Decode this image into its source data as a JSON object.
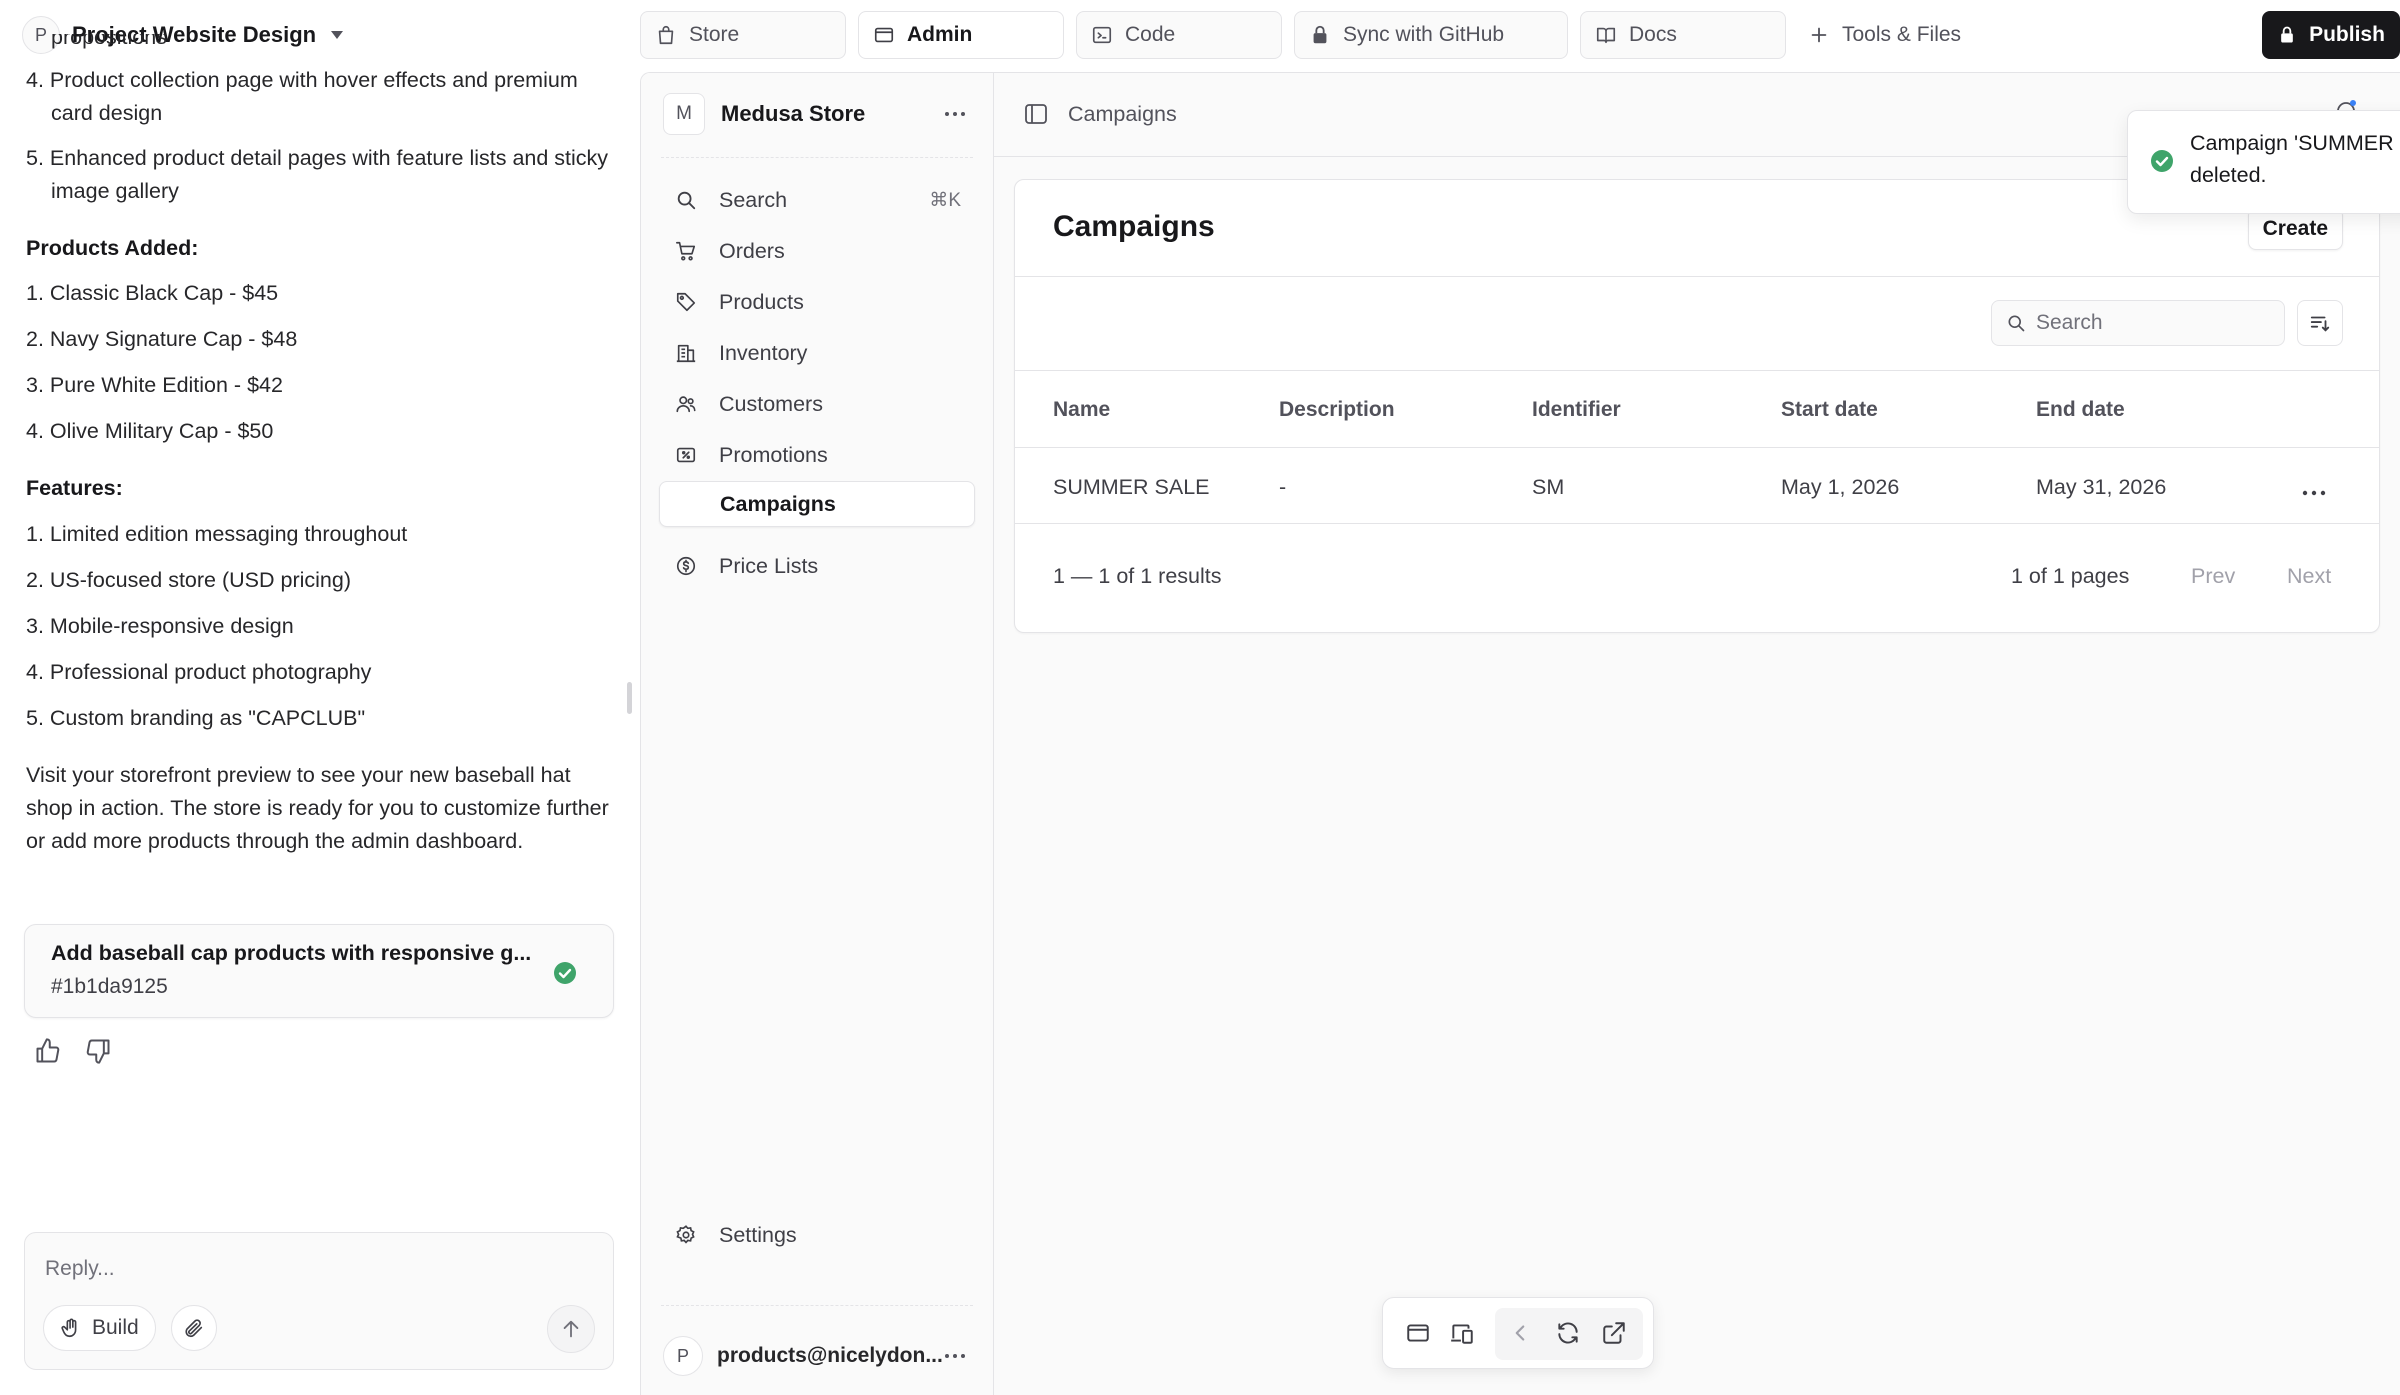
{
  "project": {
    "avatar": "P",
    "name": "Project Website Design"
  },
  "chat": {
    "cut_line": "propositions",
    "features_list_top": [
      "4. Product collection page with hover effects and premium card design",
      "5. Enhanced product detail pages with feature lists and sticky image gallery"
    ],
    "products_heading": "Products Added:",
    "products": [
      "1. Classic Black Cap - $45",
      "2. Navy Signature Cap - $48",
      "3. Pure White Edition - $42",
      "4. Olive Military Cap - $50"
    ],
    "features_heading": "Features:",
    "features": [
      "1. Limited edition messaging throughout",
      "2. US-focused store (USD pricing)",
      "3. Mobile-responsive design",
      "4. Professional product photography",
      "5. Custom branding as \"CAPCLUB\""
    ],
    "closing": "Visit your storefront preview to see your new baseball hat shop in action. The store is ready for you to customize further or add more products through the admin dashboard.",
    "commit": {
      "title": "Add baseball cap products with responsive g...",
      "hash": "#1b1da9125"
    },
    "reply_placeholder": "Reply...",
    "build_label": "Build"
  },
  "tabs": [
    {
      "label": "Store",
      "icon": "shopping-bag-icon"
    },
    {
      "label": "Admin",
      "icon": "window-icon"
    },
    {
      "label": "Code",
      "icon": "terminal-icon"
    },
    {
      "label": "Sync with GitHub",
      "icon": "lock-icon"
    },
    {
      "label": "Docs",
      "icon": "book-icon"
    }
  ],
  "tools_label": "Tools & Files",
  "publish_label": "Publish",
  "admin": {
    "store": {
      "avatar": "M",
      "name": "Medusa Store"
    },
    "nav": [
      {
        "label": "Search",
        "shortcut": "⌘K",
        "icon": "search-icon"
      },
      {
        "label": "Orders",
        "icon": "cart-icon"
      },
      {
        "label": "Products",
        "icon": "tag-icon"
      },
      {
        "label": "Inventory",
        "icon": "building-icon"
      },
      {
        "label": "Customers",
        "icon": "users-icon"
      },
      {
        "label": "Promotions",
        "icon": "receipt-percent-icon"
      },
      {
        "label": "Campaigns"
      },
      {
        "label": "Price Lists",
        "icon": "currency-dollar-icon"
      }
    ],
    "settings_label": "Settings",
    "user": {
      "avatar": "P",
      "email": "products@nicelydon..."
    },
    "breadcrumb": "Campaigns",
    "page_title": "Campaigns",
    "create_label": "Create",
    "search_placeholder": "Search",
    "columns": [
      "Name",
      "Description",
      "Identifier",
      "Start date",
      "End date"
    ],
    "rows": [
      {
        "name": "SUMMER SALE",
        "description": "-",
        "identifier": "SM",
        "start": "May 1, 2026",
        "end": "May 31, 2026"
      }
    ],
    "results": "1 — 1 of 1 results",
    "pages": "1 of 1 pages",
    "prev": "Prev",
    "next": "Next",
    "toast": "Campaign 'SUMMER SALE' was successfully deleted."
  },
  "colors": {
    "accent_green": "#3fa46a",
    "dark": "#18181b",
    "border": "#e4e4e7"
  }
}
